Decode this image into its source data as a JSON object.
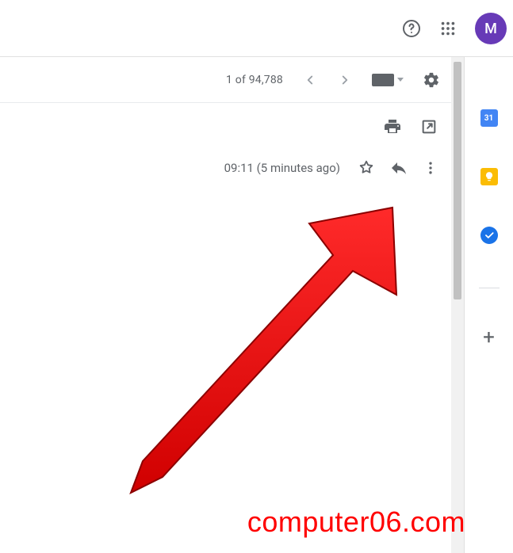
{
  "header": {
    "avatar_initial": "M"
  },
  "toolbar": {
    "pager_text": "1 of 94,788"
  },
  "message": {
    "timestamp": "09:11 (5 minutes ago)"
  },
  "sidepanel": {
    "calendar_day": "31"
  },
  "watermark": "computer06.com"
}
